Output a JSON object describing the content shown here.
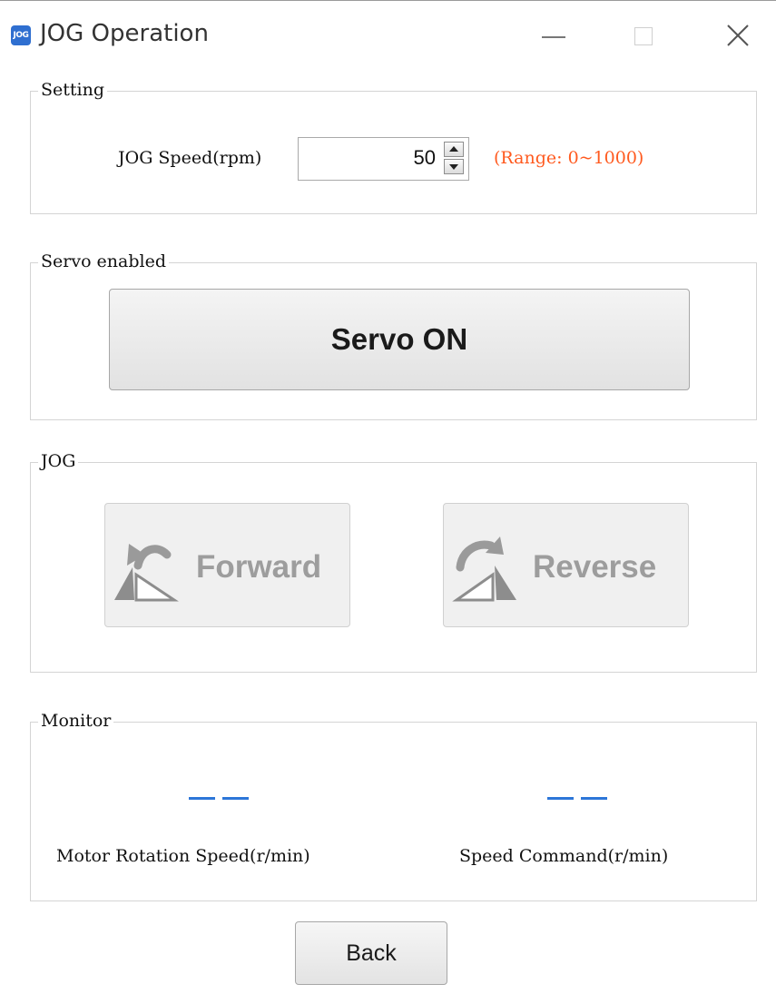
{
  "window": {
    "title": "JOG Operation",
    "app_icon_text": "JOG",
    "controls": [
      "minimize-icon",
      "maximize-icon",
      "close-icon"
    ]
  },
  "setting": {
    "group_title": "Setting",
    "speed_label": "JOG Speed(rpm)",
    "speed_value": "50",
    "range_text": "(Range: 0~1000)",
    "range_color": "#ff5a1f"
  },
  "servo": {
    "group_title": "Servo enabled",
    "button_label": "Servo ON"
  },
  "jog": {
    "group_title": "JOG",
    "forward_label": "Forward",
    "reverse_label": "Reverse",
    "forward_icon": "jog-forward-icon",
    "reverse_icon": "jog-reverse-icon"
  },
  "monitor": {
    "group_title": "Monitor",
    "motor_speed_label": "Motor Rotation Speed(r/min)",
    "speed_command_label": "Speed Command(r/min)",
    "value_color": "#2d76d8"
  },
  "footer": {
    "back_label": "Back"
  }
}
